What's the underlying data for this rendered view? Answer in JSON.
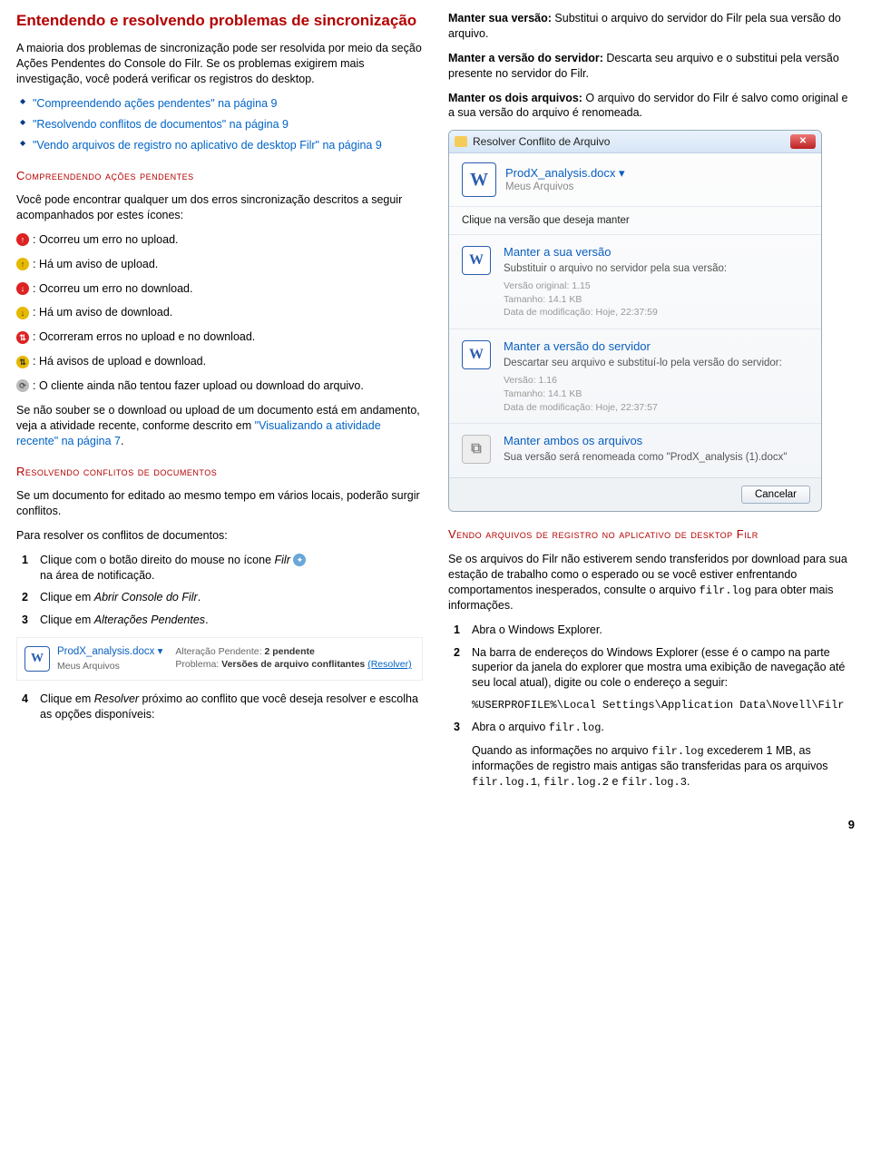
{
  "left": {
    "title": "Entendendo e resolvendo problemas de sincronização",
    "intro1": "A maioria dos problemas de sincronização pode ser resolvida por meio da seção Ações Pendentes do Console do Filr. Se os problemas exigirem mais investigação, você poderá verificar os registros do desktop.",
    "bullets": [
      "\"Compreendendo ações pendentes\" na página 9",
      "\"Resolvendo conflitos de documentos\" na página 9",
      "\"Vendo arquivos de registro no aplicativo de desktop Filr\" na página 9"
    ],
    "h2a": "Compreendendo ações pendentes",
    "p2": "Você pode encontrar qualquer um dos erros sincronização descritos a seguir acompanhados por estes ícones:",
    "s1": ": Ocorreu um erro no upload.",
    "s2": ": Há um aviso de upload.",
    "s3": ": Ocorreu um erro no download.",
    "s4": ": Há um aviso de download.",
    "s5": ": Ocorreram erros no upload e no download.",
    "s6": ": Há avisos de upload e download.",
    "s7": ": O cliente ainda não tentou fazer upload ou download do arquivo.",
    "p3a": "Se não souber se o download ou upload de um documento está em andamento, veja a atividade recente, conforme descrito em ",
    "p3link": "\"Visualizando a atividade recente\" na página 7",
    "p3b": ".",
    "h2b": "Resolvendo conflitos de documentos",
    "p4": "Se um documento for editado ao mesmo tempo em vários locais, poderão surgir conflitos.",
    "p5": "Para resolver os conflitos de documentos:",
    "step1a": "Clique com o botão direito do mouse no  ícone ",
    "step1b": "Filr",
    "step1c": " na área de notificação.",
    "step2a": "Clique em ",
    "step2b": "Abrir Console do Filr",
    "step2c": ".",
    "step3a": "Clique em ",
    "step3b": "Alterações Pendentes",
    "step3c": ".",
    "listing": {
      "fname": "ProdX_analysis.docx ▾",
      "floc": "Meus Arquivos",
      "pend_lbl": "Alteração Pendente: ",
      "pend_val": "2 pendente",
      "prob_lbl": "Problema: ",
      "prob_val": "Versões de arquivo conflitantes ",
      "resolver": "(Resolver)"
    },
    "step4a": "Clique em ",
    "step4b": "Resolver",
    "step4c": " próximo ao conflito que você deseja resolver e escolha as opções disponíveis:"
  },
  "right": {
    "o1b": "Manter sua versão:",
    "o1": " Substitui o arquivo do servidor do Filr pela sua versão do arquivo.",
    "o2b": "Manter a versão do servidor:",
    "o2": " Descarta seu arquivo e o substitui pela versão presente no servidor do Filr.",
    "o3b": "Manter os dois arquivos:",
    "o3": " O arquivo do servidor do Filr é salvo como original e a sua versão do arquivo é renomeada.",
    "dialog": {
      "wintitle": "Resolver Conflito de Arquivo",
      "fname": "ProdX_analysis.docx ▾",
      "floc": "Meus Arquivos",
      "prompt": "Clique na versão que deseja manter",
      "opt1_t": "Manter a sua versão",
      "opt1_s": "Substituir o arquivo no servidor pela sua versão:",
      "opt1_m1": "Versão original: 1.15",
      "opt1_m2": "Tamanho: 14.1 KB",
      "opt1_m3": "Data de modificação: Hoje, 22:37:59",
      "opt2_t": "Manter a versão do servidor",
      "opt2_s": "Descartar seu arquivo e substituí-lo pela versão do servidor:",
      "opt2_m1": "Versão: 1.16",
      "opt2_m2": "Tamanho: 14.1 KB",
      "opt2_m3": "Data de modificação: Hoje, 22:37:57",
      "opt3_t": "Manter ambos os arquivos",
      "opt3_s": "Sua versão será renomeada como \"ProdX_analysis (1).docx\"",
      "cancel": "Cancelar"
    },
    "h2c": "Vendo arquivos de registro no aplicativo de desktop Filr",
    "p6a": "Se os arquivos do Filr não estiverem sendo transferidos por download para sua estação de trabalho como o esperado ou se você estiver enfrentando comportamentos inesperados, consulte o arquivo ",
    "p6code": "filr.log",
    "p6b": " para obter mais informações.",
    "r_step1": "Abra o Windows Explorer.",
    "r_step2": "Na barra de endereços do Windows Explorer (esse é o campo na parte superior da janela do explorer que mostra uma exibição de navegação até seu local atual), digite ou cole o endereço a seguir:",
    "r_path": "%USERPROFILE%\\Local Settings\\Application Data\\Novell\\Filr",
    "r_step3a": "Abra o arquivo ",
    "r_step3code": "filr.log",
    "r_step3b": ".",
    "r_p7a": "Quando as informações no arquivo ",
    "r_p7c1": "filr.log",
    "r_p7b": " excederem 1 MB, as informações de registro mais antigas são transferidas para os arquivos ",
    "r_p7c2": "filr.log.1",
    "r_p7c3": "filr.log.2",
    "r_p7c4": "filr.log.3",
    "r_p7sep1": ", ",
    "r_p7sep2": " e ",
    "r_p7end": "."
  },
  "page": "9"
}
